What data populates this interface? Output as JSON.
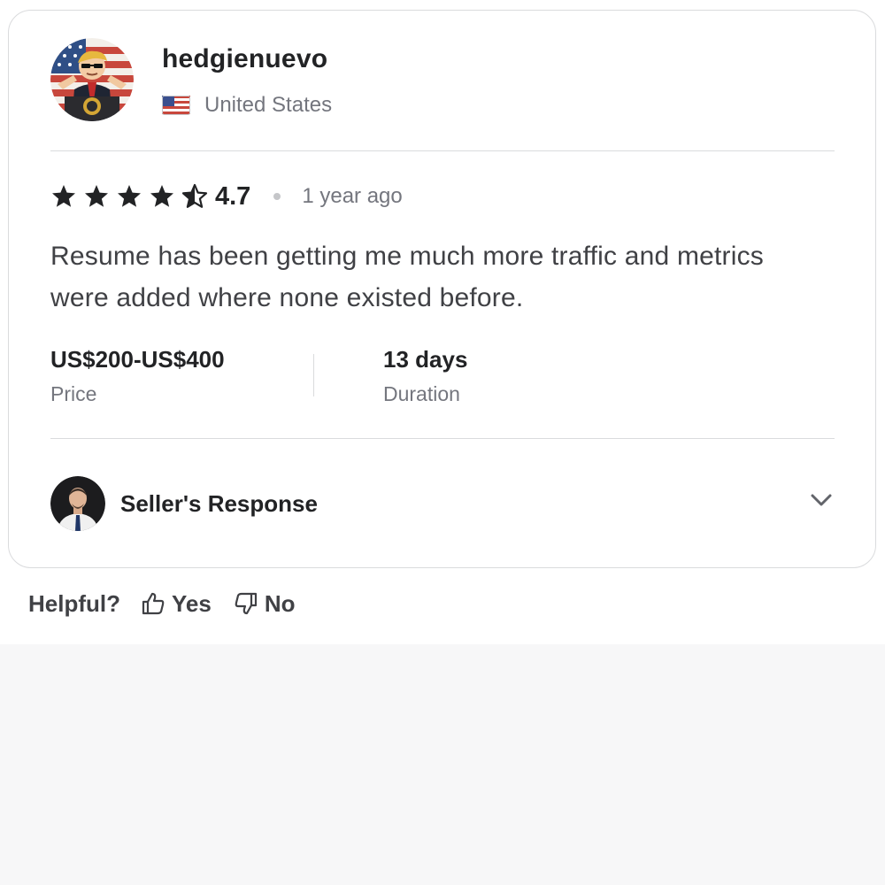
{
  "reviewer": {
    "username": "hedgienuevo",
    "country": "United States",
    "avatar_icon": "cartoon-avatar-icon",
    "flag_icon": "us-flag-icon"
  },
  "rating": {
    "score": "4.7",
    "stars": 4.7,
    "max_stars": 5,
    "time_ago": "1 year ago"
  },
  "review": {
    "text": "Resume has been getting me much more traffic and metrics were added where none existed before."
  },
  "meta": {
    "price_value": "US$200-US$400",
    "price_label": "Price",
    "duration_value": "13 days",
    "duration_label": "Duration"
  },
  "seller_response": {
    "label": "Seller's Response",
    "avatar_icon": "seller-avatar-icon",
    "chevron_icon": "chevron-down-icon"
  },
  "helpful": {
    "label": "Helpful?",
    "yes_label": "Yes",
    "no_label": "No",
    "yes_icon": "thumbs-up-icon",
    "no_icon": "thumbs-down-icon"
  },
  "colors": {
    "text_primary": "#222325",
    "text_body": "#404145",
    "text_muted": "#74767e",
    "border": "#dadbdd",
    "page_bottom_bg": "#f7f7f8"
  }
}
